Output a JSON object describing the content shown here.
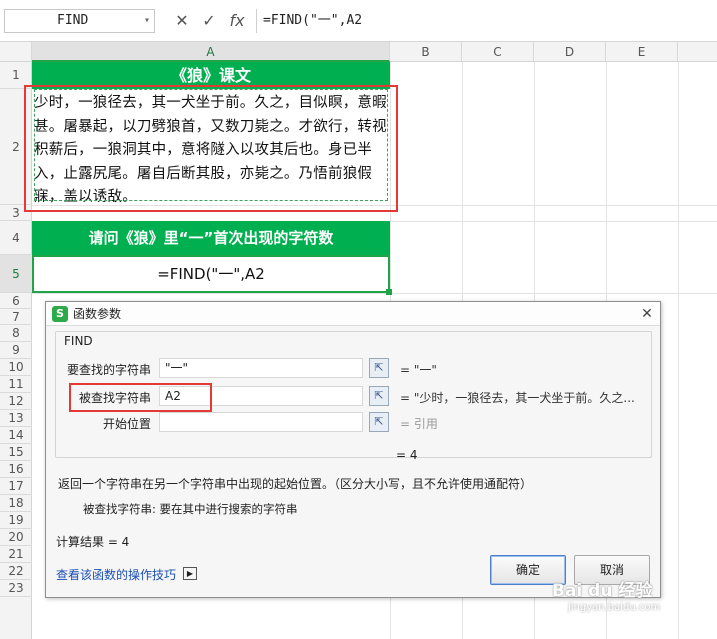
{
  "formula_bar": {
    "name_box": "FIND",
    "cancel_icon": "✕",
    "enter_icon": "✓",
    "fx_label": "fx",
    "formula": "=FIND(\"一\",A2"
  },
  "columns": [
    "A",
    "B",
    "C",
    "D",
    "E"
  ],
  "rows": [
    "1",
    "2",
    "3",
    "4",
    "5",
    "6",
    "7",
    "8",
    "9",
    "10",
    "11",
    "12",
    "13",
    "14",
    "15",
    "16",
    "17",
    "18",
    "19",
    "20",
    "21",
    "22",
    "23"
  ],
  "cells": {
    "a1": "《狼》课文",
    "a2": "少时，一狼径去，其一犬坐于前。久之，目似瞑，意暇甚。屠暴起，以刀劈狼首，又数刀毙之。才欲行，转视积薪后，一狼洞其中，意将隧入以攻其后也。身已半入，止露尻尾。屠自后断其股，亦毙之。乃悟前狼假寐，盖以诱敌。",
    "a4": "请问《狼》里“一”首次出现的字符数",
    "a5": "=FIND(\"一\",A2"
  },
  "dialog": {
    "title": "函数参数",
    "close_icon": "✕",
    "function_name": "FIND",
    "args": [
      {
        "label": "要查找的字符串",
        "value": "\"一\"",
        "result": "= \"一\""
      },
      {
        "label": "被查找字符串",
        "value": "A2",
        "result": "= \"少时，一狼径去，其一犬坐于前。久之..."
      },
      {
        "label": "开始位置",
        "value": "",
        "result": "= 引用"
      }
    ],
    "formula_result": "= 4",
    "description": "返回一个字符串在另一个字符串中出现的起始位置。（区分大小写，且不允许使用通配符）",
    "arg_description": "被查找字符串:   要在其中进行搜索的字符串",
    "calc_result": "计算结果 = 4",
    "help_link": "查看该函数的操作技巧",
    "ok": "确定",
    "cancel": "取消"
  },
  "watermark": {
    "brand": "Bai du 经验",
    "url": "jingyan.baidu.com"
  },
  "colors": {
    "header_green": "#00b050",
    "highlight_red": "#e53935",
    "selection_green": "#21a348"
  }
}
